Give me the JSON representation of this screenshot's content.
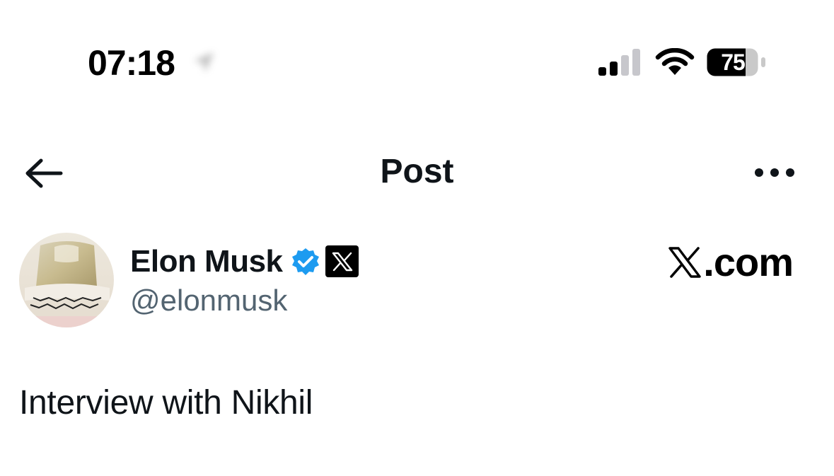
{
  "status_bar": {
    "time": "07:18",
    "battery_level": "75",
    "location_icon": "location-arrow-icon",
    "signal_icon": "cellular-signal-icon",
    "wifi_icon": "wifi-icon",
    "battery_icon": "battery-icon"
  },
  "header": {
    "title": "Post",
    "back_icon": "arrow-left-icon",
    "more_icon": "more-horizontal-icon"
  },
  "author": {
    "display_name": "Elon Musk",
    "handle": "@elonmusk",
    "verified_icon": "verified-check-icon",
    "affiliate_icon": "x-logo-icon"
  },
  "watermark": {
    "text": ".com"
  },
  "post": {
    "text": "Interview with Nikhil"
  },
  "colors": {
    "text_primary": "#0f1419",
    "text_secondary": "#536471",
    "verified_blue": "#1d9bf0",
    "background": "#ffffff"
  }
}
